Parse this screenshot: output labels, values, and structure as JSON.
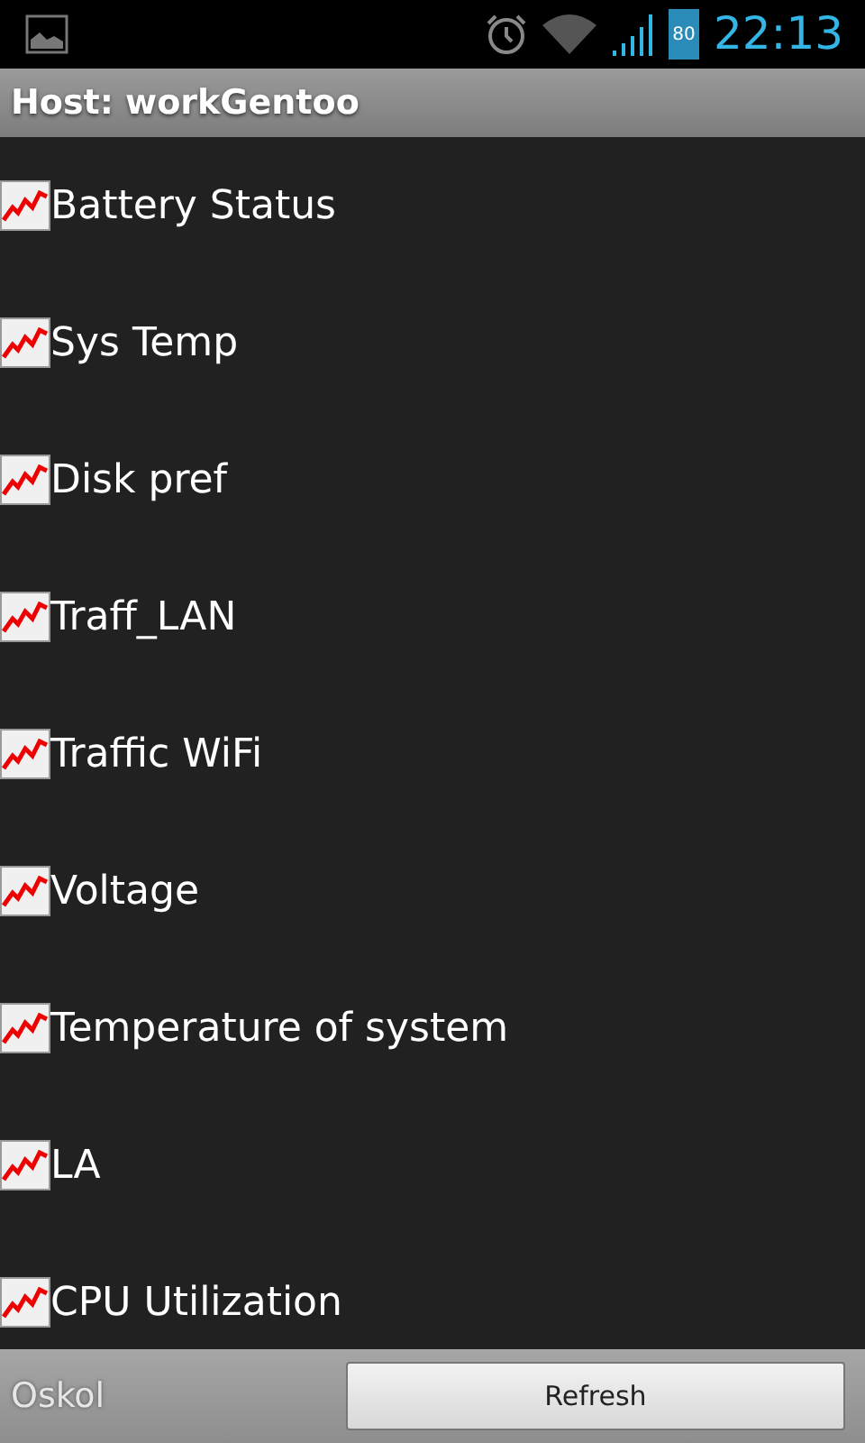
{
  "status_bar": {
    "battery": "80",
    "time": "22:13"
  },
  "title": "Host: workGentoo",
  "graphs": [
    {
      "label": "Battery Status"
    },
    {
      "label": "Sys Temp"
    },
    {
      "label": "Disk pref"
    },
    {
      "label": "Traff_LAN"
    },
    {
      "label": "Traffic WiFi"
    },
    {
      "label": "Voltage"
    },
    {
      "label": "Temperature of system"
    },
    {
      "label": "LA"
    },
    {
      "label": "CPU Utilization"
    }
  ],
  "footer": {
    "location": "Oskol",
    "button": "Refresh"
  }
}
